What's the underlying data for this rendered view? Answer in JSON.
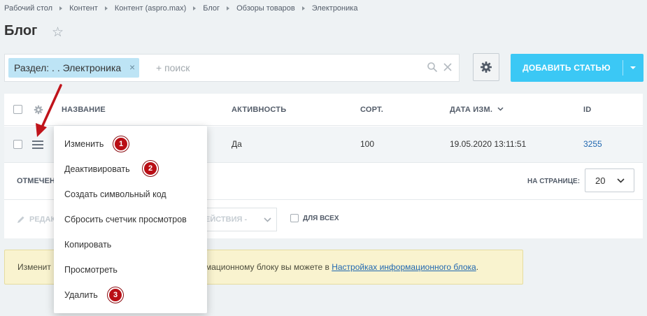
{
  "breadcrumb": [
    "Рабочий стол",
    "Контент",
    "Контент (aspro.max)",
    "Блог",
    "Обзоры товаров",
    "Электроника"
  ],
  "page": {
    "title": "Блог"
  },
  "filter": {
    "tag_label": "Раздел: . . Электроника",
    "placeholder": "+ поиск"
  },
  "toolbar": {
    "add_label": "ДОБАВИТЬ СТАТЬЮ"
  },
  "grid": {
    "columns": {
      "name": "НАЗВАНИЕ",
      "active": "АКТИВНОСТЬ",
      "sort": "СОРТ.",
      "date": "ДАТА ИЗМ.",
      "id": "ID"
    },
    "rows": [
      {
        "active": "Да",
        "sort": "100",
        "date": "19.05.2020 13:11:51",
        "id": "3255"
      }
    ],
    "footer": {
      "marked_label": "ОТМЕЧЕН",
      "per_page_label": "НА СТРАНИЦЕ:",
      "per_page_value": "20"
    },
    "actions": {
      "edit_label": "РЕДАК",
      "actions_label": "ЕЙСТВИЯ -",
      "for_all_label": "ДЛЯ ВСЕХ"
    }
  },
  "notice": {
    "text_start": "Изменит",
    "text_mid": "мационному блоку вы можете в ",
    "link": "Настройках информационного блока",
    "text_end": "."
  },
  "context_menu": {
    "items": [
      {
        "label": "Изменить",
        "badge": "1"
      },
      {
        "label": "Деактивировать",
        "badge": "2"
      },
      {
        "label": "Создать символьный код"
      },
      {
        "label": "Сбросить счетчик просмотров"
      },
      {
        "label": "Копировать"
      },
      {
        "label": "Просмотреть"
      },
      {
        "label": "Удалить",
        "badge": "3"
      }
    ]
  },
  "colors": {
    "accent": "#3bc8f5",
    "badge": "#b90e15",
    "link": "#2067b0",
    "notice_bg": "#f9f3cf"
  }
}
